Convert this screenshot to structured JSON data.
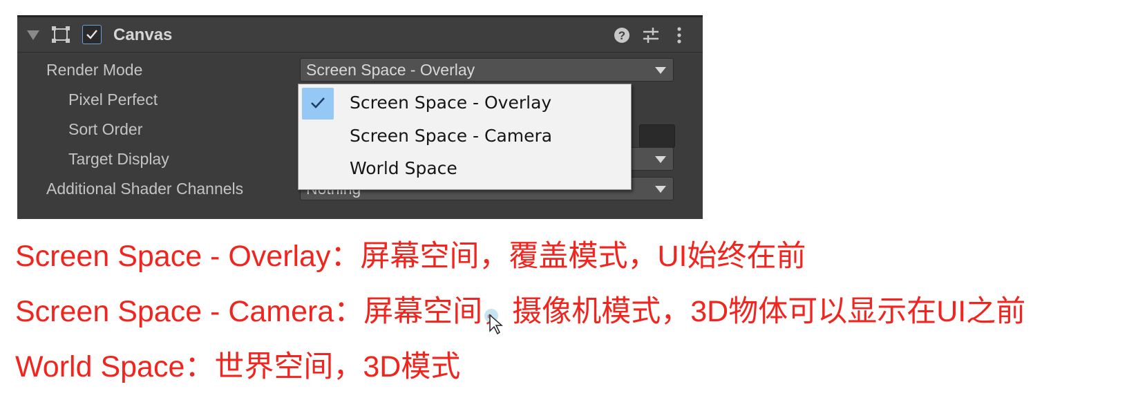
{
  "component": {
    "title": "Canvas",
    "enabled": true,
    "icons": [
      "canvas-rect-icon",
      "help-icon",
      "presets-icon",
      "kebab-menu-icon"
    ]
  },
  "properties": {
    "render_mode": {
      "label": "Render Mode",
      "value": "Screen Space - Overlay"
    },
    "pixel_perfect": {
      "label": "Pixel Perfect"
    },
    "sort_order": {
      "label": "Sort Order"
    },
    "target_display": {
      "label": "Target Display"
    },
    "additional_shader_channels": {
      "label": "Additional Shader Channels",
      "value": "Nothing"
    }
  },
  "dropdown": {
    "options": [
      {
        "label": "Screen Space - Overlay",
        "selected": true
      },
      {
        "label": "Screen Space - Camera",
        "selected": false
      },
      {
        "label": "World Space",
        "selected": false
      }
    ]
  },
  "notes": [
    "Screen Space - Overlay：屏幕空间，覆盖模式，UI始终在前",
    "Screen Space - Camera：屏幕空间，摄像机模式，3D物体可以显示在UI之前",
    "World Space：世界空间，3D模式"
  ],
  "colors": {
    "panel_bg": "#3c3c3c",
    "note_text": "#f2241e",
    "selected_highlight": "#95c8f5"
  }
}
